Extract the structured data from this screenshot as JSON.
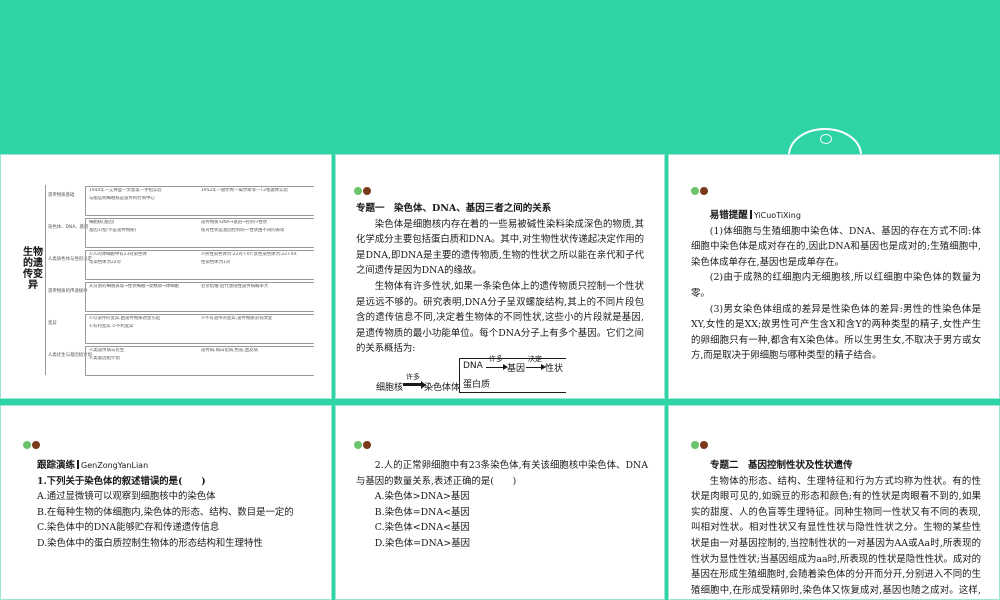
{
  "slide1": {
    "vertical_title": "生物的遗传变异",
    "map_rows": [
      {
        "label": "遗传物质基础",
        "items": [
          "1944年—艾弗里—文意美—手指实验",
          "1952年—赫尔希—威尔斯等—T2噬菌体实验",
          "与能证明细胞核是遗传的控制中心"
        ]
      },
      {
        "label": "染色体、DNA、基因",
        "items": [
          "细胞核(基因)",
          "遗传物质:DNA→基因→控制→性状",
          "基因1(指:不是遗传物质)",
          "核对性状是基因控制的一性状由不同的表现"
        ]
      },
      {
        "label": "人类染色体与性别决定",
        "items": [
          "①人的体细胞中有23对染色体",
          "②男性染色体为:22对+XY;女性染色体为:22+XX",
          "常染色体为22对",
          "性染色体为1对"
        ]
      },
      {
        "label": "遗传物质的传递规律",
        "items": [
          "从分割的细胞表现→性状细胞→受精卵→体细胞",
          "近亲结婚:后代患隐性遗传病概率大"
        ]
      },
      {
        "label": "变异",
        "items": [
          "①可遗传的变异,由遗传物质改变引起",
          "②不可遗传的变异,遗传物质没有改变",
          "①有利变异 ②不利变异"
        ]
      },
      {
        "label": "人类优生与基因组计划",
        "items": [
          "人类遗传病与优生",
          "遗传病,如白化病,色盲,血友病",
          "人类基因组计划"
        ]
      }
    ]
  },
  "slide2": {
    "heading": "专题一　染色体、DNA、基因三者之间的关系",
    "paragraphs": [
      "染色体是细胞核内存在着的一些易被碱性染料染成深色的物质,其化学成分主要包括蛋白质和DNA。其中,对生物性状传递起决定作用的是DNA,即DNA是主要的遗传物质,生物的性状之所以能在亲代和子代之间遗传是因为DNA的缘故。",
      "生物体有许多性状,如果一条染色体上的遗传物质只控制一个性状是远远不够的。研究表明,DNA分子呈双螺旋结构,其上的不同片段包含的遗传信息不同,决定着生物体的不同性状,这些小的片段就是基因,是遗传物质的最小功能单位。每个DNA分子上有多个基因。它们之间的关系概括为:"
    ],
    "diagram": {
      "nucleus": "细胞核",
      "arrow1": "许多",
      "chromosome": "染色体",
      "dna": "DNA",
      "arrow2": "许多",
      "gene": "基因",
      "arrow3": "决定",
      "trait": "性状",
      "protein": "蛋白质"
    }
  },
  "slide3": {
    "heading": "易错提醒",
    "pinyin": "YiCuoTiXing",
    "paragraphs": [
      "(1)体细胞与生殖细胞中染色体、DNA、基因的存在方式不同:体细胞中染色体是成对存在的,因此DNA和基因也是成对的;生殖细胞中,染色体成单存在,基因也是成单存在。",
      "(2)由于成熟的红细胞内无细胞核,所以红细胞中染色体的数量为零。",
      "(3)男女染色体组成的差异是性染色体的差异:男性的性染色体是XY,女性的是XX;故男性可产生含X和含Y的两种类型的精子,女性产生的卵细胞只有一种,都含有X染色体。所以生男生女,不取决于男方或女方,而是取决于卵细胞与哪种类型的精子结合。"
    ]
  },
  "slide4": {
    "heading": "跟踪演练",
    "pinyin": "GenZongYanLian",
    "question": "1.下列关于染色体的叙述错误的是(　　)",
    "options": [
      "A.通过显微镜可以观察到细胞核中的染色体",
      "B.在每种生物的体细胞内,染色体的形态、结构、数目是一定的",
      "C.染色体中的DNA能够贮存和传递遗传信息",
      "D.染色体中的蛋白质控制生物体的形态结构和生理特性"
    ]
  },
  "slide5": {
    "question": "2.人的正常卵细胞中有23条染色体,有关该细胞核中染色体、DNA与基因的数量关系,表述正确的是(　　)",
    "options": [
      "A.染色体>DNA>基因",
      "B.染色体=DNA<基因",
      "C.染色体<DNA<基因",
      "D.染色体=DNA>基因"
    ]
  },
  "slide6": {
    "heading": "专题二　基因控制性状及性状遗传",
    "paragraph": "生物体的形态、结构、生理特征和行为方式均称为性状。有的性状是肉眼可见的,如豌豆的形态和颜色;有的性状是肉眼看不到的,如果实的甜度、人的色盲等生理特征。同种生物同一性状又有不同的表现,叫相对性状。相对性状又有显性性状与隐性性状之分。生物的某些性状是由一对基因控制的,当控制性状的一对基因为AA或Aa时,所表现的性状为显性性状;当基因组成为aa时,所表现的性状是隐性性状。成对的基因在形成生殖细胞时,会随着染色体的分开而分开,分别进入不同的生殖细胞中,在形成受精卵时,染色体又恢复成对,基因也随之成对。这样,亲代的染色体(基因)就通过精子或卵细胞传递给了子代。"
  }
}
